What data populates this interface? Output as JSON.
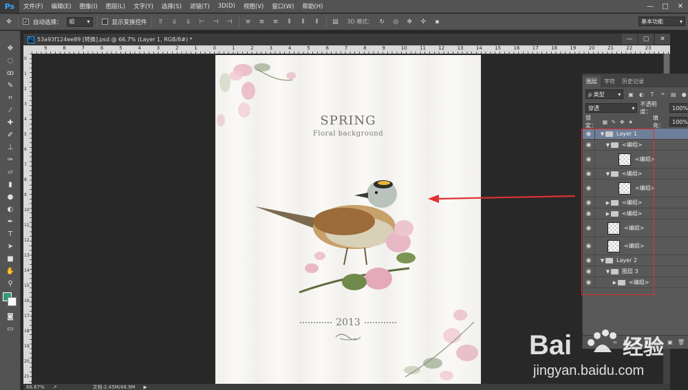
{
  "app": {
    "logo": "Ps"
  },
  "menu": [
    "文件(F)",
    "编辑(E)",
    "图像(I)",
    "图层(L)",
    "文字(Y)",
    "选择(S)",
    "滤镜(T)",
    "3D(D)",
    "视图(V)",
    "窗口(W)",
    "帮助(H)"
  ],
  "options": {
    "auto_select_label": "自动选择：",
    "auto_select_value": "组",
    "show_transform_label": "显示变换控件",
    "mode_3d_label": "3D 模式：",
    "workspace": "基本功能"
  },
  "document": {
    "tab_title": "53a93f124ee89 [转换].psd @ 66.7% (Layer 1, RGB/8#) *",
    "zoom": "66.67%",
    "doc_size": "文档:2.45M/48.9M"
  },
  "ruler": {
    "h_ticks": [
      "9",
      "8",
      "7",
      "6",
      "5",
      "4",
      "3",
      "2",
      "1",
      "0",
      "1",
      "2",
      "3",
      "4",
      "5",
      "6",
      "7",
      "8",
      "9",
      "10",
      "11",
      "12",
      "13",
      "14",
      "15",
      "16",
      "17",
      "18",
      "19",
      "20",
      "21",
      "22",
      "23"
    ],
    "v_ticks": [
      "0",
      "1",
      "2",
      "3",
      "4",
      "5",
      "6",
      "7",
      "8",
      "9",
      "10",
      "11",
      "12",
      "13",
      "14",
      "15",
      "16",
      "17",
      "18",
      "19",
      "20",
      "21"
    ]
  },
  "artwork": {
    "title": "SPRING",
    "subtitle": "Floral background",
    "year": "2013"
  },
  "layers_panel": {
    "tabs": [
      "图层",
      "字符",
      "历史记录"
    ],
    "filter_label": "ρ 类型",
    "blend_mode": "穿透",
    "opacity_label": "不透明度：",
    "opacity_value": "100%",
    "lock_label": "锁定：",
    "fill_label": "填充：",
    "fill_value": "100%",
    "layers": [
      {
        "name": "Layer 1",
        "type": "group",
        "expanded": true,
        "selected": true
      },
      {
        "name": "<编组>",
        "type": "group",
        "expanded": true
      },
      {
        "name": "<编组>",
        "type": "layer"
      },
      {
        "name": "<编组>",
        "type": "group",
        "expanded": true
      },
      {
        "name": "<编组>",
        "type": "layer"
      },
      {
        "name": "<编组>",
        "type": "group",
        "expanded": false
      },
      {
        "name": "<编组>",
        "type": "group",
        "expanded": false
      },
      {
        "name": "<编组>",
        "type": "layer"
      },
      {
        "name": "<编组>",
        "type": "layer"
      },
      {
        "name": "Layer 2",
        "type": "group",
        "expanded": true
      },
      {
        "name": "图层 3",
        "type": "group",
        "expanded": true
      },
      {
        "name": "<编组>",
        "type": "group",
        "expanded": false
      }
    ]
  },
  "watermark": {
    "brand": "Bai",
    "brand2": "经验",
    "url": "jingyan.baidu.com"
  },
  "colors": {
    "accent_red": "#e03030",
    "selection": "#6e7f99",
    "ps_blue": "#31a8ff"
  }
}
